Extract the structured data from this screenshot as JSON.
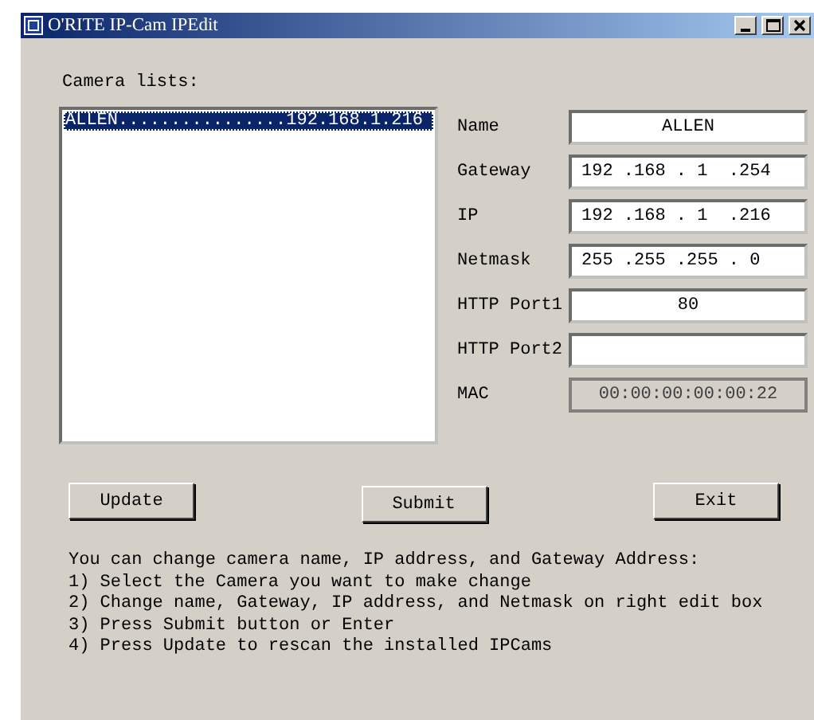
{
  "window": {
    "title": "O'RITE IP-Cam  IPEdit"
  },
  "camera_list": {
    "label": "Camera lists:",
    "items": [
      {
        "name": "ALLEN",
        "dots": "................",
        "ip": "192.168.1.216",
        "selected": true
      }
    ]
  },
  "fields": [
    {
      "label": "Name",
      "value": "ALLEN",
      "kind": "text",
      "disabled": false
    },
    {
      "label": "Gateway",
      "value": "192 .168 . 1  .254",
      "kind": "ip",
      "disabled": false
    },
    {
      "label": "IP",
      "value": "192 .168 . 1  .216",
      "kind": "ip",
      "disabled": false
    },
    {
      "label": "Netmask",
      "value": "255 .255 .255 . 0",
      "kind": "ip",
      "disabled": false
    },
    {
      "label": "HTTP Port1",
      "value": "80",
      "kind": "text",
      "disabled": false
    },
    {
      "label": "HTTP Port2",
      "kind": "text",
      "disabled": false
    },
    {
      "label": "MAC",
      "value": "00:00:00:00:00:22",
      "kind": "text",
      "disabled": true
    }
  ],
  "buttons": [
    {
      "label": "Update"
    },
    {
      "label": "Submit"
    },
    {
      "label": "Exit"
    }
  ],
  "instructions": [
    "You can change camera name, IP address, and Gateway Address:",
    "1) Select the Camera you want to make change",
    "2) Change name, Gateway, IP address, and Netmask on right edit box",
    "3) Press Submit button or Enter",
    "4) Press Update to rescan the installed IPCams"
  ]
}
